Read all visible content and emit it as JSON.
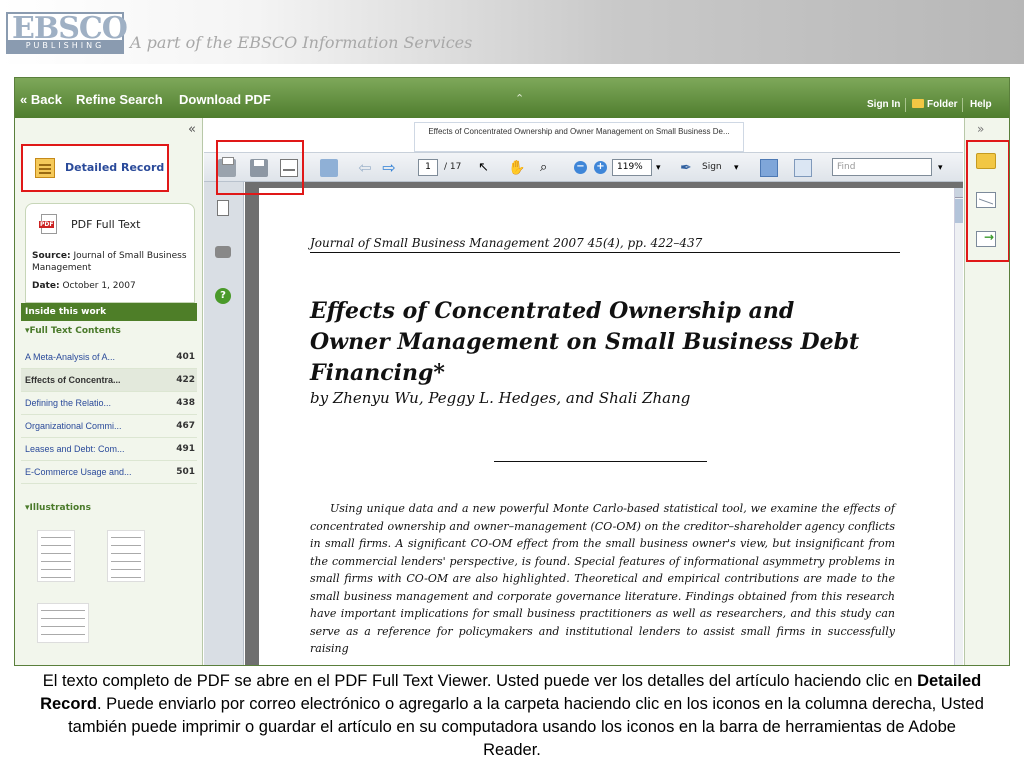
{
  "banner": {
    "logo_main": "EBSCO",
    "logo_sub": "PUBLISHING",
    "tagline": "A part of the EBSCO Information Services"
  },
  "topbar": {
    "back": "« Back",
    "refine": "Refine Search",
    "download": "Download PDF",
    "sign_in": "Sign In",
    "folder": "Folder",
    "help": "Help"
  },
  "left": {
    "collapse": "«",
    "detailed_record": "Detailed Record",
    "pdf_full_text": "PDF Full Text",
    "source_label": "Source:",
    "source_value": "Journal of Small Business Management",
    "date_label": "Date:",
    "date_value": "October 1,  2007",
    "inside": "Inside this work",
    "full_text_contents": "▾Full Text Contents",
    "toc": [
      {
        "title": "A Meta-Analysis of A...",
        "page": "401"
      },
      {
        "title": "Effects of Concentra...",
        "page": "422"
      },
      {
        "title": "Defining the Relatio...",
        "page": "438"
      },
      {
        "title": "Organizational Commi...",
        "page": "467"
      },
      {
        "title": "Leases and Debt: Com...",
        "page": "491"
      },
      {
        "title": "E-Commerce Usage and...",
        "page": "501"
      }
    ],
    "illustrations": "▾Illustrations"
  },
  "viewer": {
    "tab_title": "Effects of Concentrated Ownership and Owner Management on Small Business De...",
    "page_current": "1",
    "page_total": "/ 17",
    "zoom": "119%",
    "sign": "Sign",
    "find_placeholder": "Find"
  },
  "document": {
    "journal": "Journal of Small Business Management 2007 45(4), pp. 422–437",
    "title": "Effects of Concentrated Ownership and Owner Management on Small Business Debt Financing*",
    "authors": "by Zhenyu Wu, Peggy L. Hedges, and Shali Zhang",
    "abstract": "Using unique data and a new powerful Monte Carlo-based statistical tool, we examine the effects of concentrated ownership and owner–management (CO-OM) on the creditor–shareholder agency conflicts in small firms. A significant CO-OM effect from the small business owner's view, but insignificant from the commercial lenders' perspective, is found. Special features of informational asymmetry problems in small firms with CO-OM are also highlighted. Theoretical and empirical contributions are made to the small business management and corporate governance literature. Findings obtained from this research have important implications for small business practitioners as well as researchers, and this study can serve as a reference for policymakers and institutional lenders to assist small firms in successfully raising"
  },
  "right": {
    "collapse": "»"
  },
  "caption": {
    "part1": "El texto completo de PDF se abre en el PDF Full Text Viewer. Usted puede ver los detalles del artículo haciendo clic en ",
    "bold": "Detailed Record",
    "part2": ". Puede enviarlo por correo electrónico o agregarlo a la carpeta haciendo clic en los iconos en la columna derecha, Usted también puede imprimir o guardar el artículo en su computadora usando los iconos en la barra de herramientas de Adobe Reader."
  }
}
